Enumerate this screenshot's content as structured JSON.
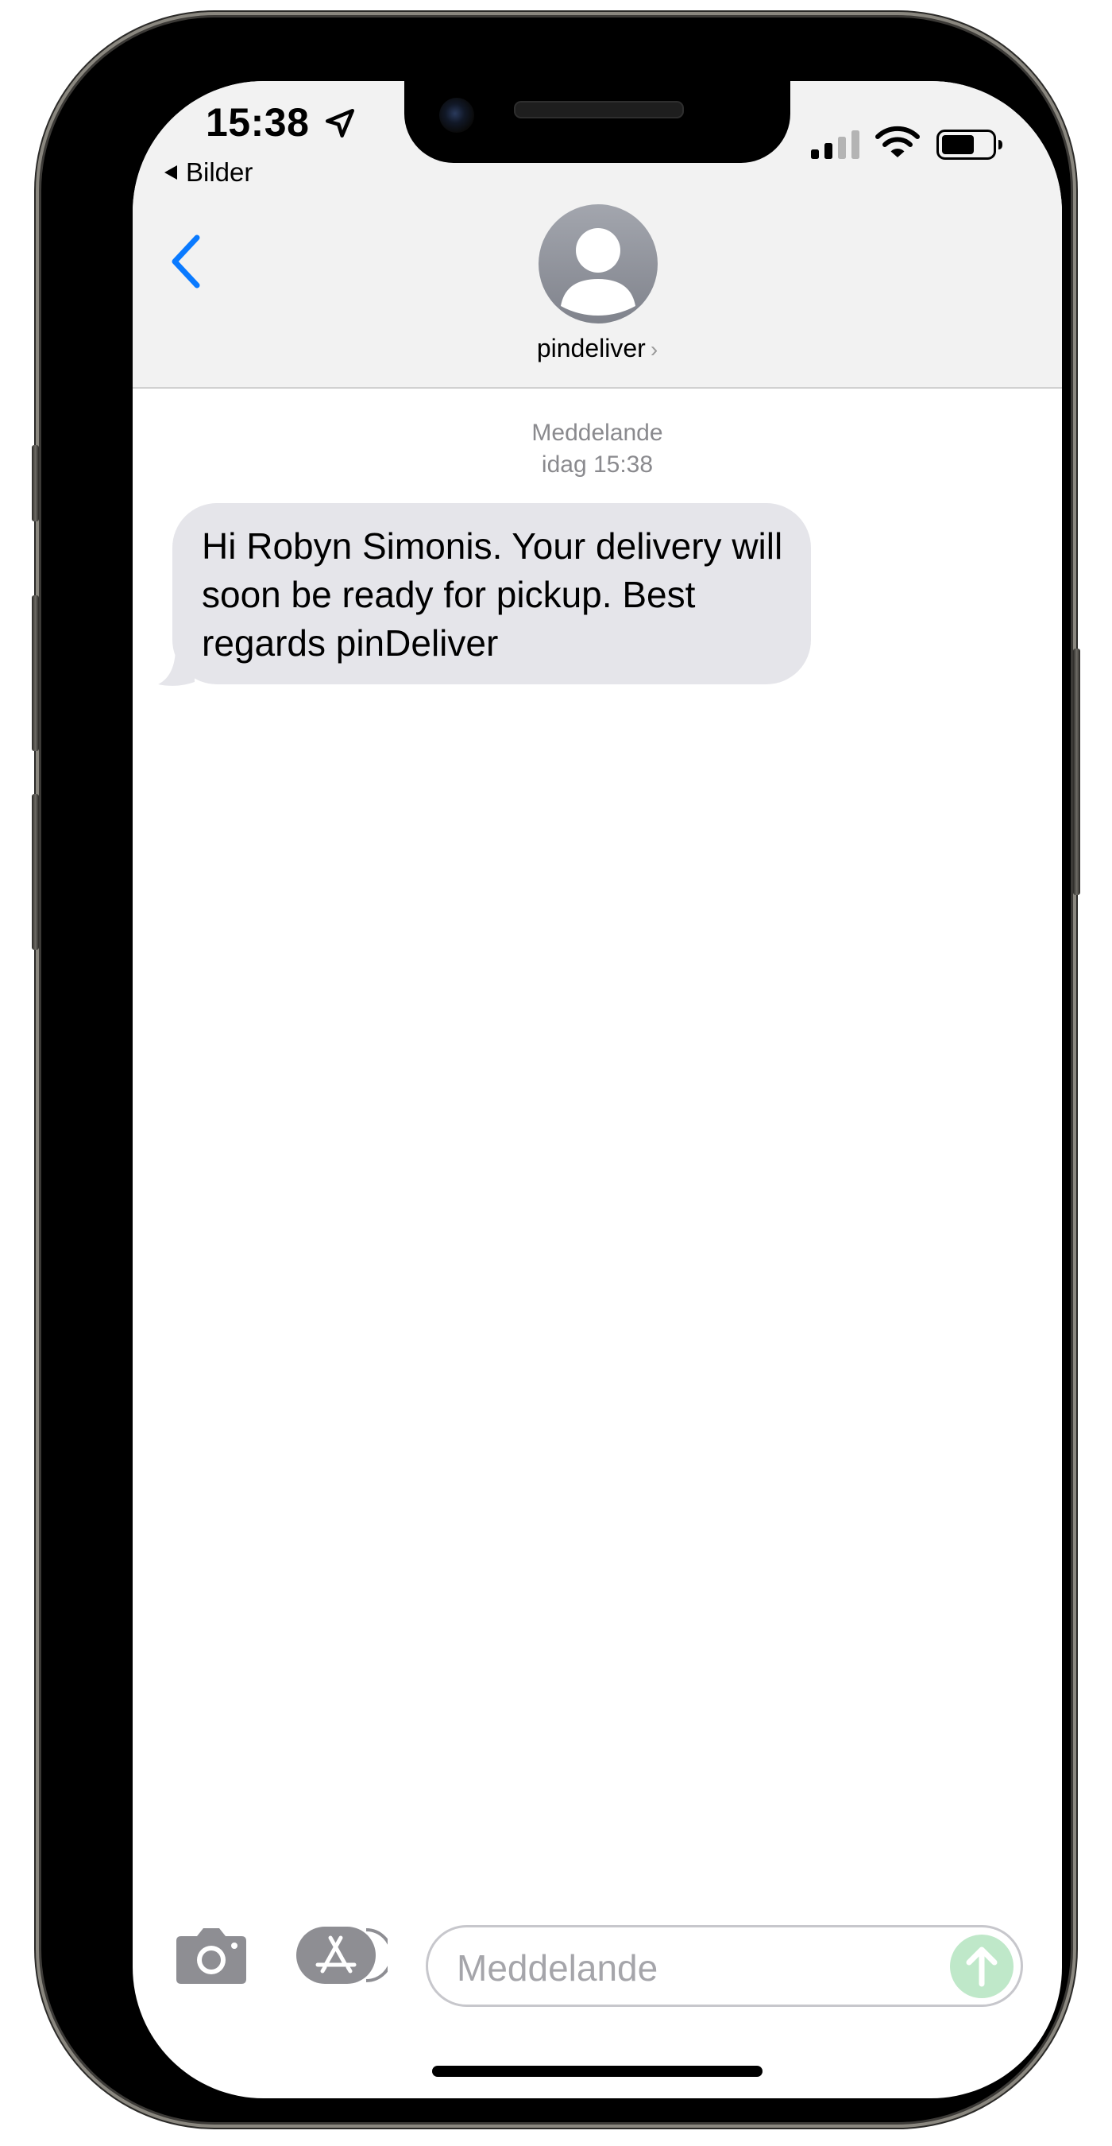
{
  "status_bar": {
    "time": "15:38",
    "back_app_label": "Bilder"
  },
  "header": {
    "contact_name": "pindeliver",
    "contact_chevron": "›"
  },
  "conversation": {
    "service_label": "Meddelande",
    "timestamp": "idag 15:38",
    "messages": [
      {
        "direction": "incoming",
        "text": "Hi Robyn Simonis. Your delivery will soon be ready for pickup. Best regards pinDeliver"
      }
    ]
  },
  "input_bar": {
    "placeholder": "Meddelande"
  },
  "colors": {
    "accent": "#0a7aff",
    "incoming_bubble": "#e5e5ea",
    "send_button": "#bfe8c9",
    "header_background": "#f2f2f2"
  },
  "icons": {
    "back": "chevron-left-icon",
    "location": "location-arrow-icon",
    "signal": "cellular-signal-icon",
    "wifi": "wifi-icon",
    "battery": "battery-icon",
    "avatar": "person-icon",
    "camera": "camera-icon",
    "app_store": "app-store-icon",
    "send": "arrow-up-icon"
  }
}
